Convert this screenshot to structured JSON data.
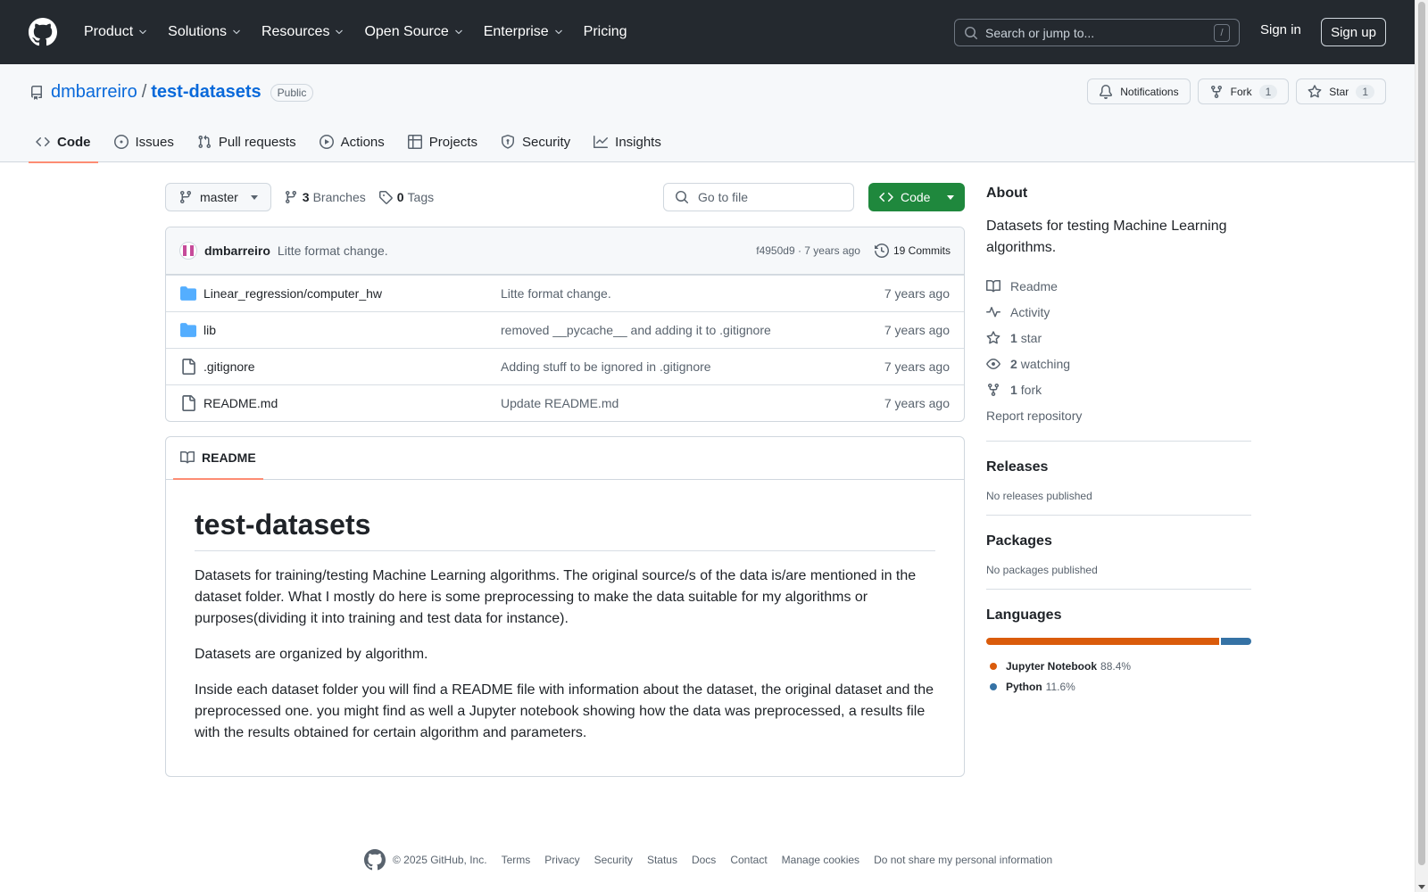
{
  "header": {
    "nav": [
      {
        "label": "Product",
        "dropdown": true
      },
      {
        "label": "Solutions",
        "dropdown": true
      },
      {
        "label": "Resources",
        "dropdown": true
      },
      {
        "label": "Open Source",
        "dropdown": true
      },
      {
        "label": "Enterprise",
        "dropdown": true
      },
      {
        "label": "Pricing",
        "dropdown": false
      }
    ],
    "search_placeholder": "Search or jump to...",
    "search_shortcut": "/",
    "sign_in": "Sign in",
    "sign_up": "Sign up"
  },
  "repo": {
    "owner": "dmbarreiro",
    "separator": "/",
    "name": "test-datasets",
    "visibility": "Public",
    "notifications_label": "Notifications",
    "fork_label": "Fork",
    "fork_count": "1",
    "star_label": "Star",
    "star_count": "1",
    "tabs": [
      {
        "label": "Code",
        "icon": "code-icon",
        "active": true
      },
      {
        "label": "Issues",
        "icon": "issue-icon",
        "active": false
      },
      {
        "label": "Pull requests",
        "icon": "pull-request-icon",
        "active": false
      },
      {
        "label": "Actions",
        "icon": "play-icon",
        "active": false
      },
      {
        "label": "Projects",
        "icon": "table-icon",
        "active": false
      },
      {
        "label": "Security",
        "icon": "shield-icon",
        "active": false
      },
      {
        "label": "Insights",
        "icon": "graph-icon",
        "active": false
      }
    ]
  },
  "toolbar": {
    "branch": "master",
    "branches_count": "3",
    "branches_label": "Branches",
    "tags_count": "0",
    "tags_label": "Tags",
    "goto_placeholder": "Go to file",
    "code_button": "Code"
  },
  "latest_commit": {
    "author": "dmbarreiro",
    "message": "Litte format change.",
    "meta": "f4950d9 · 7 years ago",
    "commits_label": "19 Commits"
  },
  "files": [
    {
      "type": "folder",
      "name": "Linear_regression/computer_hw",
      "commit": "Litte format change.",
      "age": "7 years ago"
    },
    {
      "type": "folder",
      "name": "lib",
      "commit": "removed __pycache__ and adding it to .gitignore",
      "age": "7 years ago"
    },
    {
      "type": "file",
      "name": ".gitignore",
      "commit": "Adding stuff to be ignored in .gitignore",
      "age": "7 years ago"
    },
    {
      "type": "file",
      "name": "README.md",
      "commit": "Update README.md",
      "age": "7 years ago"
    }
  ],
  "readme": {
    "tab_label": "README",
    "title": "test-datasets",
    "paragraphs": [
      "Datasets for training/testing Machine Learning algorithms. The original source/s of the data is/are mentioned in the dataset folder. What I mostly do here is some preprocessing to make the data suitable for my algorithms or purposes(dividing it into training and test data for instance).",
      "Datasets are organized by algorithm.",
      "Inside each dataset folder you will find a README file with information about the dataset, the original dataset and the preprocessed one. you might find as well a Jupyter notebook showing how the data was preprocessed, a results file with the results obtained for certain algorithm and parameters."
    ]
  },
  "sidebar": {
    "about_title": "About",
    "about_desc": "Datasets for testing Machine Learning algorithms.",
    "readme_label": "Readme",
    "activity_label": "Activity",
    "stars_count": "1",
    "stars_label": "star",
    "watching_count": "2",
    "watching_label": "watching",
    "forks_count": "1",
    "forks_label": "fork",
    "report_label": "Report repository",
    "releases_title": "Releases",
    "releases_empty": "No releases published",
    "packages_title": "Packages",
    "packages_empty": "No packages published",
    "languages_title": "Languages",
    "languages": [
      {
        "name": "Jupyter Notebook",
        "percent": "88.4%",
        "share": 88.4,
        "color": "#DA5B0B"
      },
      {
        "name": "Python",
        "percent": "11.6%",
        "share": 11.6,
        "color": "#3572A5"
      }
    ]
  },
  "footer": {
    "copyright": "© 2025 GitHub, Inc.",
    "links": [
      "Terms",
      "Privacy",
      "Security",
      "Status",
      "Docs",
      "Contact",
      "Manage cookies",
      "Do not share my personal information"
    ]
  }
}
